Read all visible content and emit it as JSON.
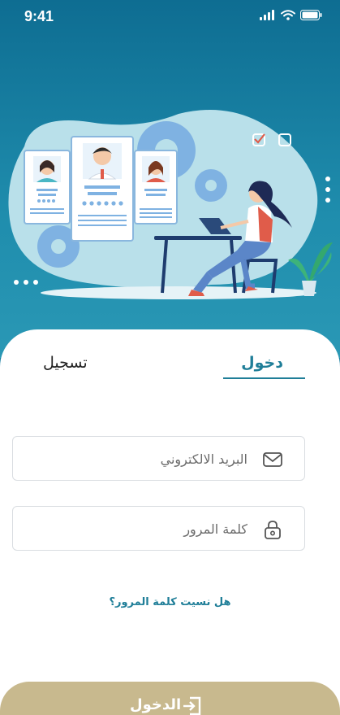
{
  "status_bar": {
    "time": "9:41",
    "icons": [
      "signal-icon",
      "wifi-icon",
      "battery-icon"
    ]
  },
  "tabs": {
    "login_label": "دخول",
    "register_label": "تسجيل",
    "active": "login"
  },
  "form": {
    "email_placeholder": "البريد الالكتروني",
    "password_placeholder": "كلمة المرور",
    "forgot_password": "هل نسيت كلمة المرور؟"
  },
  "login_button": {
    "label": "الدخول"
  },
  "colors": {
    "header_top": "#0e6d92",
    "header_bottom": "#2a98b5",
    "accent": "#1f7e98",
    "button": "#c8b98e"
  }
}
